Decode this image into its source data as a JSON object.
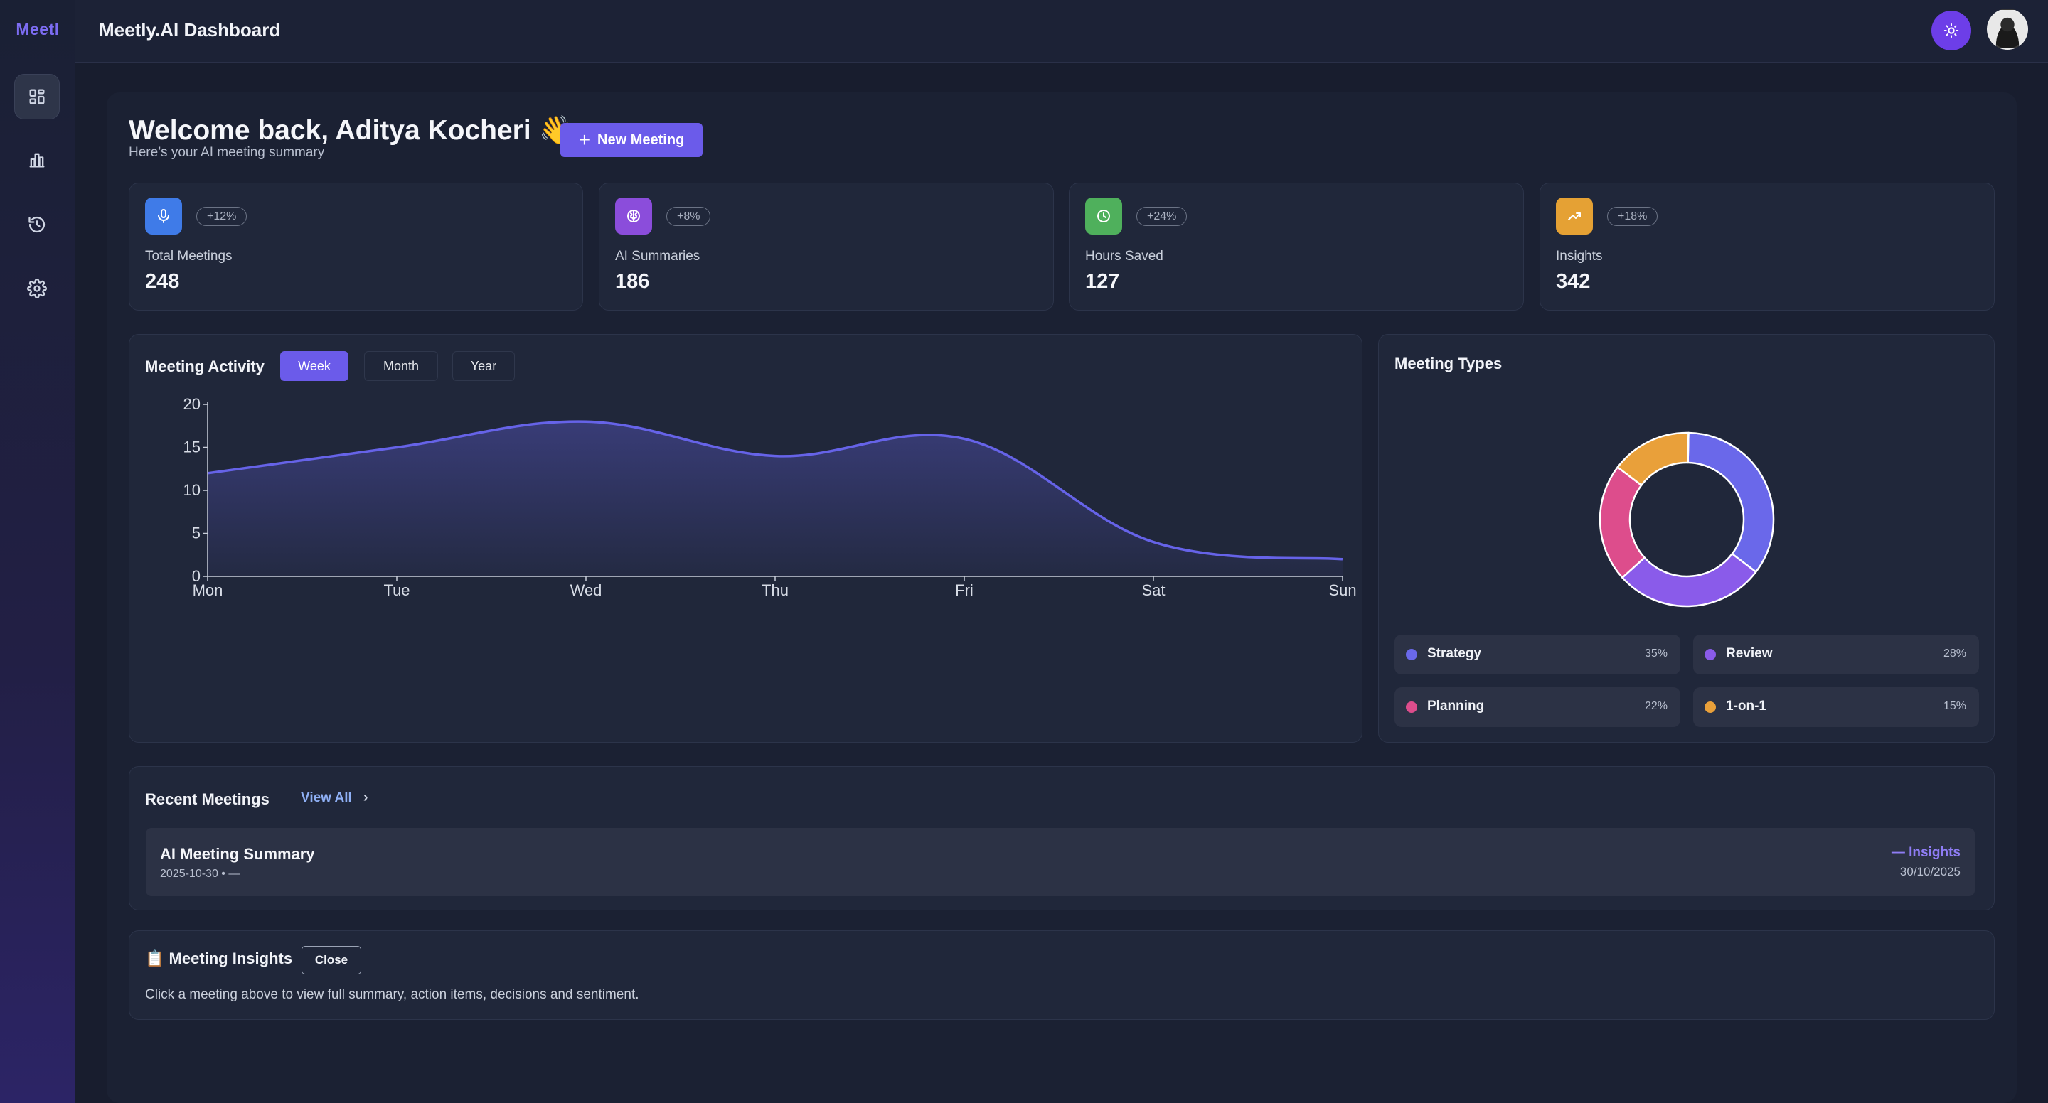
{
  "sidebar": {
    "logo": "Meetl",
    "items": [
      {
        "icon": "dashboard-icon",
        "active": true
      },
      {
        "icon": "bar-chart-icon",
        "active": false
      },
      {
        "icon": "history-icon",
        "active": false
      },
      {
        "icon": "gear-icon",
        "active": false
      }
    ]
  },
  "header": {
    "title": "Meetly.AI Dashboard",
    "theme_icon": "sun-icon",
    "avatar_icon": "user-avatar"
  },
  "welcome": {
    "title": "Welcome back, Aditya Kocheri 👋",
    "subtitle": "Here’s your AI meeting summary",
    "new_meeting_label": "New Meeting"
  },
  "stats": [
    {
      "label": "Total Meetings",
      "value": "248",
      "change": "+12%",
      "icon": "microphone-icon",
      "color": "#3f7be8"
    },
    {
      "label": "AI Summaries",
      "value": "186",
      "change": "+8%",
      "icon": "brain-icon",
      "color": "#8b4ddb"
    },
    {
      "label": "Hours Saved",
      "value": "127",
      "change": "+24%",
      "icon": "clock-icon",
      "color": "#4fb05c"
    },
    {
      "label": "Insights",
      "value": "342",
      "change": "+18%",
      "icon": "trending-up-icon",
      "color": "#e5a134"
    }
  ],
  "activity": {
    "title": "Meeting Activity",
    "tabs": [
      {
        "label": "Week",
        "active": true
      },
      {
        "label": "Month",
        "active": false
      },
      {
        "label": "Year",
        "active": false
      }
    ]
  },
  "types": {
    "title": "Meeting Types",
    "items": [
      {
        "name": "Strategy",
        "pct": "35%",
        "color": "#6a68ea"
      },
      {
        "name": "Review",
        "pct": "28%",
        "color": "#8a5bea"
      },
      {
        "name": "Planning",
        "pct": "22%",
        "color": "#dd4d8c"
      },
      {
        "name": "1-on-1",
        "pct": "15%",
        "color": "#e9a03a"
      }
    ]
  },
  "recent": {
    "title": "Recent Meetings",
    "view_all": "View All",
    "meetings": [
      {
        "title": "AI Meeting Summary",
        "meta": "2025-10-30 • —",
        "tag": "— Insights",
        "date": "30/10/2025"
      }
    ]
  },
  "insights": {
    "title": "📋 Meeting Insights",
    "close_label": "Close",
    "description": "Click a meeting above to view full summary, action items, decisions and sentiment."
  },
  "chart_data": [
    {
      "type": "area",
      "categories": [
        "Mon",
        "Tue",
        "Wed",
        "Thu",
        "Fri",
        "Sat",
        "Sun"
      ],
      "series": [
        {
          "values": [
            12,
            15,
            18,
            14,
            16,
            4,
            2
          ]
        }
      ],
      "yticks": [
        0,
        5,
        10,
        15,
        20
      ],
      "ylim": [
        0,
        20
      ],
      "color": "#6663e8",
      "grid": false
    },
    {
      "type": "pie",
      "labels": [
        "Strategy",
        "Review",
        "Planning",
        "1-on-1"
      ],
      "values": [
        35,
        28,
        22,
        15
      ],
      "colors": [
        "#6a68ea",
        "#8a5bea",
        "#dd4d8c",
        "#e9a03a"
      ]
    }
  ]
}
